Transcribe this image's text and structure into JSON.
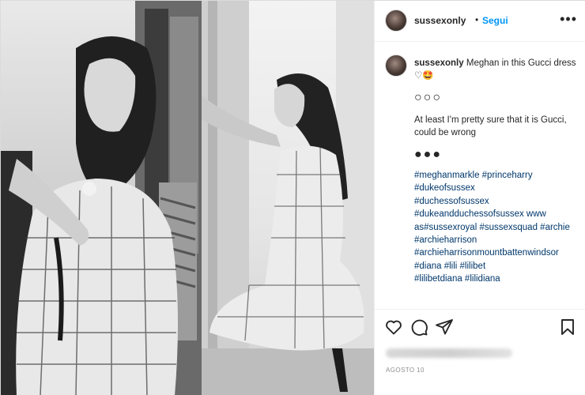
{
  "post": {
    "username": "sussexonly",
    "dot": "•",
    "follow_label": "Segui",
    "more_label": "•••",
    "caption": {
      "user": "sussexonly",
      "text": "Meghan in this Gucci dress ♡🤩",
      "glyphs_1": "○○○",
      "paragraph": "At least I'm pretty sure that it is Gucci, could be wrong",
      "glyphs_2": "●●●",
      "hashtags": [
        "#meghanmarkle #princeharry",
        "#dukeofsussex",
        "#duchessofsussex",
        "#dukeandduchessofsussex www",
        "as#sussexroyal #sussexsquad #archie",
        "#archieharrison",
        "#archieharrisonmountbattenwindsor",
        "#diana #lili #lilibet",
        "#lilibetdiana #lilidiana"
      ]
    },
    "date": "AGOSTO 10",
    "icons": [
      "heart-icon",
      "comment-icon",
      "share-icon",
      "bookmark-icon"
    ]
  }
}
